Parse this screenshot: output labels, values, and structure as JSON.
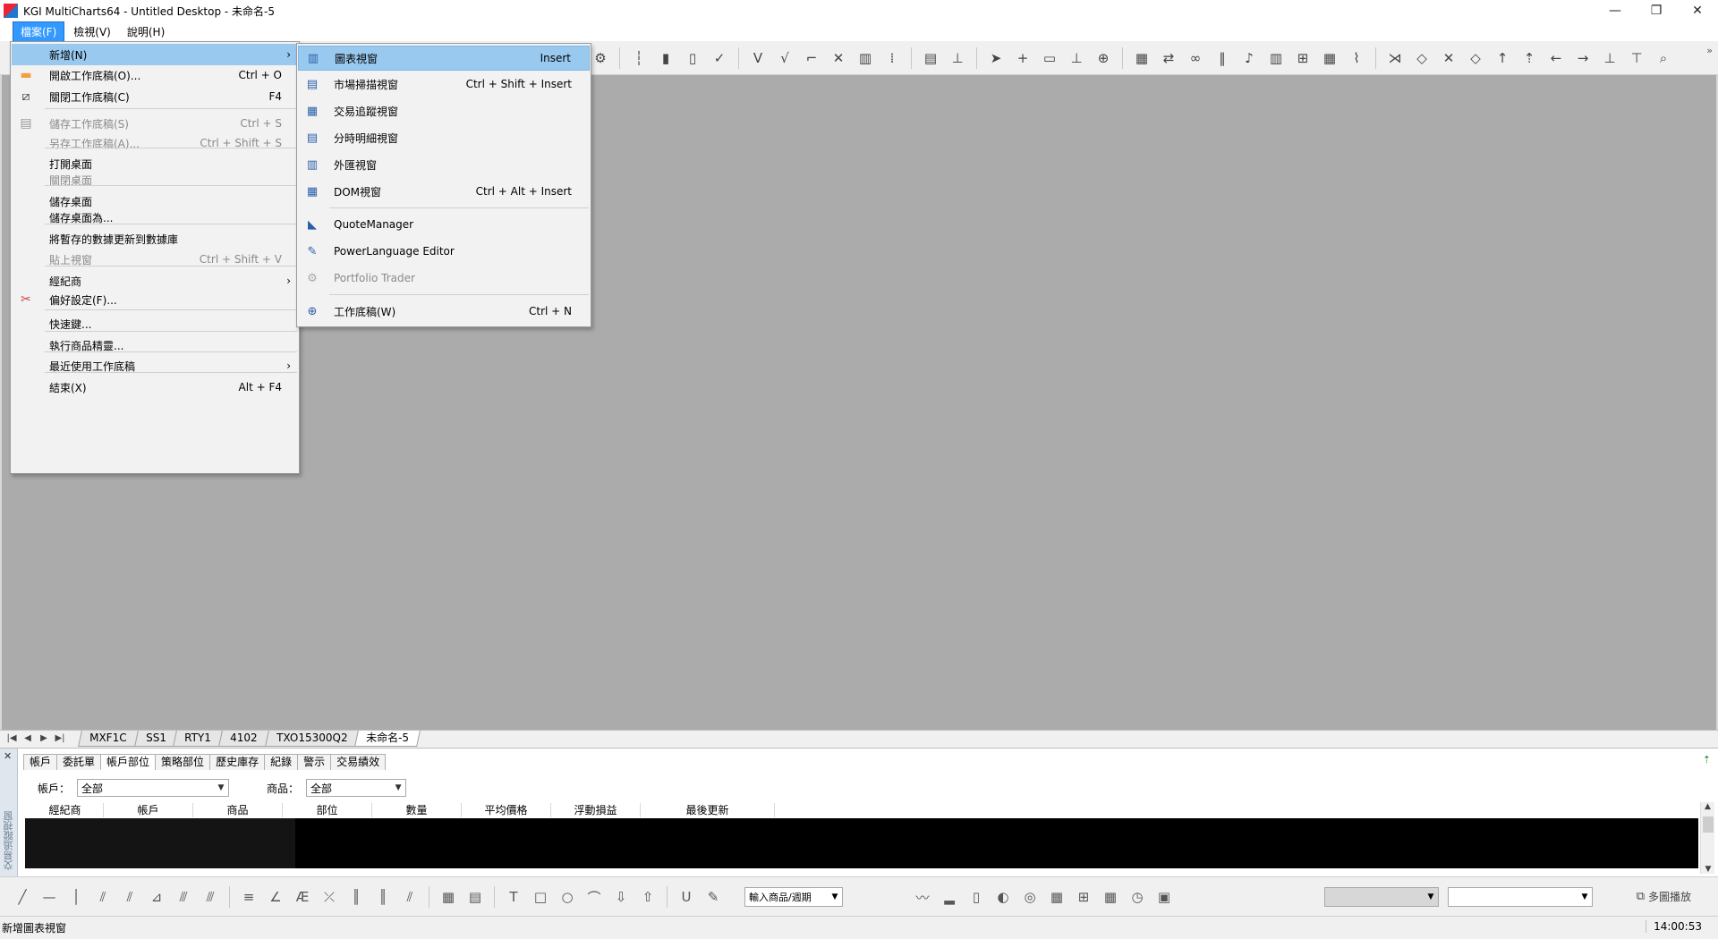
{
  "window": {
    "title": "KGI MultiCharts64 - Untitled Desktop - 未命名-5",
    "minimize": "—",
    "restore": "❐",
    "close": "✕"
  },
  "menubar": {
    "items": [
      {
        "label": "檔案(F)",
        "active": true
      },
      {
        "label": "檢視(V)",
        "active": false
      },
      {
        "label": "說明(H)",
        "active": false
      }
    ]
  },
  "file_menu": {
    "items": [
      {
        "label": "新增(N)",
        "shortcut": "",
        "submenu": true,
        "highlight": true,
        "disabled": false,
        "icon": "none"
      },
      {
        "label": "開啟工作底稿(O)...",
        "shortcut": "Ctrl + O",
        "submenu": false,
        "highlight": false,
        "disabled": false,
        "icon": "folder-icon"
      },
      {
        "label": "關閉工作底稿(C)",
        "shortcut": "F4",
        "submenu": false,
        "highlight": false,
        "disabled": false,
        "icon": "close-workspace-icon"
      },
      {
        "label": "儲存工作底稿(S)",
        "shortcut": "Ctrl + S",
        "submenu": false,
        "highlight": false,
        "disabled": true,
        "icon": "save-icon"
      },
      {
        "label": "另存工作底稿(A)...",
        "shortcut": "Ctrl + Shift + S",
        "submenu": false,
        "highlight": false,
        "disabled": true,
        "icon": "none"
      },
      {
        "label": "打開桌面",
        "shortcut": "",
        "submenu": false,
        "highlight": false,
        "disabled": false,
        "icon": "none"
      },
      {
        "label": "關閉桌面",
        "shortcut": "",
        "submenu": false,
        "highlight": false,
        "disabled": true,
        "icon": "none"
      },
      {
        "label": "儲存桌面",
        "shortcut": "",
        "submenu": false,
        "highlight": false,
        "disabled": false,
        "icon": "none"
      },
      {
        "label": "儲存桌面為...",
        "shortcut": "",
        "submenu": false,
        "highlight": false,
        "disabled": false,
        "icon": "none"
      },
      {
        "label": "將暫存的數據更新到數據庫",
        "shortcut": "",
        "submenu": false,
        "highlight": false,
        "disabled": false,
        "icon": "none"
      },
      {
        "label": "貼上視窗",
        "shortcut": "Ctrl + Shift + V",
        "submenu": false,
        "highlight": false,
        "disabled": true,
        "icon": "none"
      },
      {
        "label": "經紀商",
        "shortcut": "",
        "submenu": true,
        "highlight": false,
        "disabled": false,
        "icon": "none"
      },
      {
        "label": "偏好設定(F)...",
        "shortcut": "",
        "submenu": false,
        "highlight": false,
        "disabled": false,
        "icon": "preferences-icon"
      },
      {
        "label": "快速鍵...",
        "shortcut": "",
        "submenu": false,
        "highlight": false,
        "disabled": false,
        "icon": "none"
      },
      {
        "label": "執行商品精靈...",
        "shortcut": "",
        "submenu": false,
        "highlight": false,
        "disabled": false,
        "icon": "none"
      },
      {
        "label": "最近使用工作底稿",
        "shortcut": "",
        "submenu": true,
        "highlight": false,
        "disabled": false,
        "icon": "none"
      },
      {
        "label": "結束(X)",
        "shortcut": "Alt + F4",
        "submenu": false,
        "highlight": false,
        "disabled": false,
        "icon": "none"
      }
    ],
    "submenu_arrow": "›"
  },
  "new_submenu": {
    "items": [
      {
        "label": "圖表視窗",
        "shortcut": "Insert",
        "highlight": true,
        "disabled": false,
        "icon": "chart-window-icon"
      },
      {
        "label": "市場掃描視窗",
        "shortcut": "Ctrl + Shift + Insert",
        "highlight": false,
        "disabled": false,
        "icon": "scanner-window-icon"
      },
      {
        "label": "交易追蹤視窗",
        "shortcut": "",
        "highlight": false,
        "disabled": false,
        "icon": "order-tracker-icon"
      },
      {
        "label": "分時明細視窗",
        "shortcut": "",
        "highlight": false,
        "disabled": false,
        "icon": "time-sales-icon"
      },
      {
        "label": "外匯視窗",
        "shortcut": "",
        "highlight": false,
        "disabled": false,
        "icon": "forex-window-icon"
      },
      {
        "label": "DOM視窗",
        "shortcut": "Ctrl + Alt + Insert",
        "highlight": false,
        "disabled": false,
        "icon": "dom-window-icon"
      },
      {
        "label": "QuoteManager",
        "shortcut": "",
        "highlight": false,
        "disabled": false,
        "icon": "quotemanager-icon"
      },
      {
        "label": "PowerLanguage Editor",
        "shortcut": "",
        "highlight": false,
        "disabled": false,
        "icon": "powerlanguage-editor-icon"
      },
      {
        "label": "Portfolio Trader",
        "shortcut": "",
        "highlight": false,
        "disabled": true,
        "icon": "portfolio-trader-icon"
      },
      {
        "label": "工作底稿(W)",
        "shortcut": "Ctrl + N",
        "highlight": false,
        "disabled": false,
        "icon": "new-workspace-icon"
      }
    ]
  },
  "toolbar": {
    "overflow": "»",
    "buttons": [
      {
        "name": "settings-icon",
        "glyph": "⚙"
      },
      {
        "name": "bar-chart-icon",
        "glyph": "┆"
      },
      {
        "name": "candlestick-icon",
        "glyph": "▮"
      },
      {
        "name": "hollow-candle-icon",
        "glyph": "▯"
      },
      {
        "name": "line-chart-icon",
        "glyph": "✓"
      },
      {
        "name": "point-figure-icon",
        "glyph": "V"
      },
      {
        "name": "kagi-icon",
        "glyph": "√"
      },
      {
        "name": "step-line-icon",
        "glyph": "⌐"
      },
      {
        "name": "cross-icon",
        "glyph": "✕"
      },
      {
        "name": "renko-icon",
        "glyph": "▥"
      },
      {
        "name": "dots-icon",
        "glyph": "⁞"
      },
      {
        "name": "volume-icon",
        "glyph": "▤"
      },
      {
        "name": "tick-icon",
        "glyph": "⊥"
      },
      {
        "name": "pointer-icon",
        "glyph": "➤"
      },
      {
        "name": "crosshair-icon",
        "glyph": "+"
      },
      {
        "name": "comment-icon",
        "glyph": "▭"
      },
      {
        "name": "hline-icon",
        "glyph": "⊥"
      },
      {
        "name": "zoom-region-icon",
        "glyph": "⊕"
      },
      {
        "name": "data-window-icon",
        "glyph": "▦"
      },
      {
        "name": "trade-icon",
        "glyph": "⇄"
      },
      {
        "name": "link-icon",
        "glyph": "∞"
      },
      {
        "name": "histogram-icon",
        "glyph": "‖"
      },
      {
        "name": "bell-icon",
        "glyph": "♪"
      },
      {
        "name": "bars-icon",
        "glyph": "▥"
      },
      {
        "name": "format-icon",
        "glyph": "⊞"
      },
      {
        "name": "grid-icon",
        "glyph": "▦"
      },
      {
        "name": "performance-icon",
        "glyph": "⌇"
      },
      {
        "name": "collapse-icon",
        "glyph": "⋊"
      },
      {
        "name": "expand-icon",
        "glyph": "◇"
      },
      {
        "name": "shrink-icon",
        "glyph": "✕"
      },
      {
        "name": "diamond-icon",
        "glyph": "◇"
      },
      {
        "name": "arrow-up-icon",
        "glyph": "↑"
      },
      {
        "name": "arrow-up-alt-icon",
        "glyph": "⇡"
      },
      {
        "name": "arrow-left-icon",
        "glyph": "←"
      },
      {
        "name": "arrow-right-icon",
        "glyph": "→"
      },
      {
        "name": "scale-up-icon",
        "glyph": "⊥"
      },
      {
        "name": "scale-down-icon",
        "glyph": "⊤"
      },
      {
        "name": "zoom-icon",
        "glyph": "⌕"
      }
    ]
  },
  "workspace_tabs": {
    "nav": [
      "|◀",
      "◀",
      "▶",
      "▶|"
    ],
    "tabs": [
      {
        "label": "MXF1C",
        "active": false
      },
      {
        "label": "SS1",
        "active": false
      },
      {
        "label": "RTY1",
        "active": false
      },
      {
        "label": "4102",
        "active": false
      },
      {
        "label": "TXO15300Q2",
        "active": false
      },
      {
        "label": "未命名-5",
        "active": true
      }
    ]
  },
  "trade_panel": {
    "side_label": "交易追蹤視窗",
    "close": "✕",
    "pin": "⇡",
    "tabs": [
      {
        "label": "帳戶",
        "active": false
      },
      {
        "label": "委託單",
        "active": false
      },
      {
        "label": "帳戶部位",
        "active": true
      },
      {
        "label": "策略部位",
        "active": false
      },
      {
        "label": "歷史庫存",
        "active": false
      },
      {
        "label": "紀錄",
        "active": false
      },
      {
        "label": "警示",
        "active": false
      },
      {
        "label": "交易績效",
        "active": false
      }
    ],
    "account_label": "帳戶：",
    "account_value": "全部",
    "symbol_label": "商品：",
    "symbol_value": "全部",
    "columns": [
      "經紀商",
      "帳戶",
      "商品",
      "部位",
      "數量",
      "平均價格",
      "浮動損益",
      "最後更新"
    ],
    "scroll_up": "▲",
    "scroll_down": "▼"
  },
  "drawing_toolbar": {
    "symbol_combo": "輸入商品/週期",
    "multi_play": "多圖播放",
    "buttons": [
      {
        "name": "trend-line-icon",
        "glyph": "╱"
      },
      {
        "name": "horizontal-line-icon",
        "glyph": "—"
      },
      {
        "name": "vertical-line-icon",
        "glyph": "│"
      },
      {
        "name": "channel-icon",
        "glyph": "⫽"
      },
      {
        "name": "parallel-icon",
        "glyph": "⫽"
      },
      {
        "name": "fan-icon",
        "glyph": "⊿"
      },
      {
        "name": "gann-icon",
        "glyph": "⫻"
      },
      {
        "name": "gann-fan-icon",
        "glyph": "⫻"
      },
      {
        "name": "fib-retrace-icon",
        "glyph": "≡"
      },
      {
        "name": "angle-icon",
        "glyph": "∠"
      },
      {
        "name": "elliott-icon",
        "glyph": "Æ"
      },
      {
        "name": "speed-lines-icon",
        "glyph": "⤫"
      },
      {
        "name": "fib-time-icon",
        "glyph": "║"
      },
      {
        "name": "cycle-icon",
        "glyph": "║"
      },
      {
        "name": "regression-icon",
        "glyph": "⫽"
      },
      {
        "name": "table-icon",
        "glyph": "▦"
      },
      {
        "name": "calculator-icon",
        "glyph": "▤"
      },
      {
        "name": "text-icon",
        "glyph": "T"
      },
      {
        "name": "rectangle-icon",
        "glyph": "□"
      },
      {
        "name": "ellipse-icon",
        "glyph": "○"
      },
      {
        "name": "arc-icon",
        "glyph": "⌒"
      },
      {
        "name": "arrow-down-icon",
        "glyph": "⇩"
      },
      {
        "name": "arrow-up-draw-icon",
        "glyph": "⇧"
      },
      {
        "name": "magnet-icon",
        "glyph": "U"
      },
      {
        "name": "eraser-icon",
        "glyph": "✎"
      },
      {
        "name": "indicator-icon",
        "glyph": "〰"
      },
      {
        "name": "strategy-icon",
        "glyph": "▂"
      },
      {
        "name": "window-icon",
        "glyph": "▯"
      },
      {
        "name": "alert-icon",
        "glyph": "◐"
      },
      {
        "name": "scanner-icon",
        "glyph": "◎"
      },
      {
        "name": "format-bars-icon",
        "glyph": "▦"
      },
      {
        "name": "sync-icon",
        "glyph": "⊞"
      },
      {
        "name": "replay-icon",
        "glyph": "▦"
      },
      {
        "name": "clock-icon",
        "glyph": "◷"
      },
      {
        "name": "calendar-icon",
        "glyph": "▣"
      }
    ]
  },
  "statusbar": {
    "text": "新增圖表視窗",
    "time": "14:00:53"
  },
  "colors": {
    "highlight": "#99c9ef",
    "workspace": "#ababab",
    "menu_active": "#3399ff"
  }
}
